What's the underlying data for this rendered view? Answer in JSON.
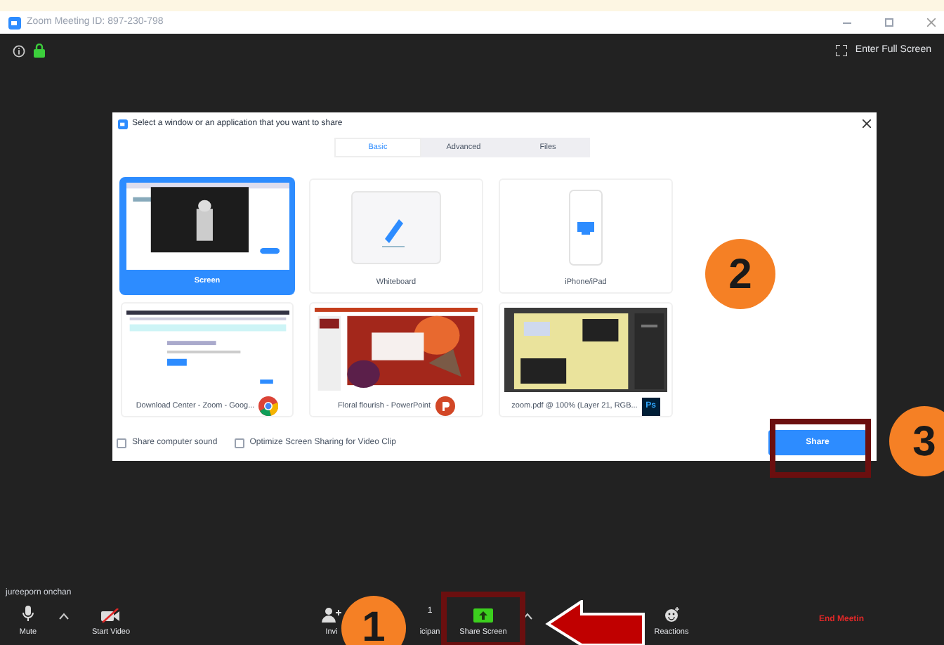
{
  "window": {
    "title": "Zoom Meeting ID: 897-230-798"
  },
  "meeting_bar": {
    "full_screen": "Enter Full Screen"
  },
  "dialog": {
    "title": "Select a window or an application that you want to share",
    "tabs": [
      {
        "label": "Basic",
        "selected": true
      },
      {
        "label": "Advanced",
        "selected": false
      },
      {
        "label": "Files",
        "selected": false
      }
    ],
    "items": [
      {
        "label": "Screen",
        "kind": "screen",
        "selected": true
      },
      {
        "label": "Whiteboard",
        "kind": "whiteboard",
        "selected": false
      },
      {
        "label": "iPhone/iPad",
        "kind": "device",
        "selected": false
      },
      {
        "label": "Download Center - Zoom - Goog...",
        "kind": "browser",
        "selected": false
      },
      {
        "label": "Floral flourish - PowerPoint",
        "kind": "slides",
        "selected": false
      },
      {
        "label": "zoom.pdf @ 100% (Layer 21, RGB...",
        "kind": "editor",
        "app_badge": "Ps",
        "selected": false
      }
    ],
    "options": [
      {
        "label": "Share computer sound",
        "checked": false
      },
      {
        "label": "Optimize Screen Sharing for Video Clip",
        "checked": false
      }
    ],
    "share_button": {
      "label": "Share",
      "highlighted": true
    }
  },
  "participant_name": "jureeporn onchan",
  "toolbar": [
    {
      "kind": "mic",
      "label": "Mute"
    },
    {
      "kind": "caret"
    },
    {
      "kind": "video_off",
      "label": "Start Video"
    },
    {
      "kind": "invite",
      "label": "Invi"
    },
    {
      "kind": "participants",
      "label": "icipan",
      "count": "1"
    },
    {
      "kind": "share",
      "label": "Share Screen",
      "highlighted": true
    },
    {
      "kind": "caret"
    },
    {
      "kind": "reactions",
      "label": "Reactions"
    },
    {
      "kind": "end",
      "label": "End Meetin"
    }
  ],
  "annotations": [
    {
      "label": "1"
    },
    {
      "label": "2"
    },
    {
      "label": "3"
    }
  ]
}
